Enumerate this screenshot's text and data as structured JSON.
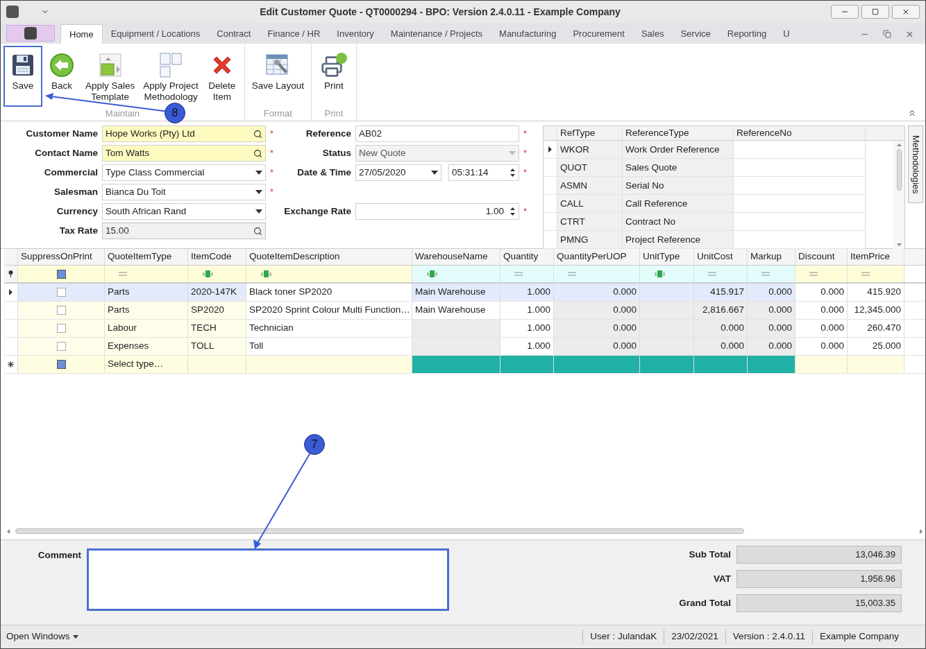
{
  "window": {
    "title": "Edit Customer Quote - QT0000294 - BPO: Version 2.4.0.11 - Example Company"
  },
  "ribbon_tabs": [
    {
      "label": "Home",
      "selected": true
    },
    {
      "label": "Equipment / Locations",
      "selected": false
    },
    {
      "label": "Contract",
      "selected": false
    },
    {
      "label": "Finance / HR",
      "selected": false
    },
    {
      "label": "Inventory",
      "selected": false
    },
    {
      "label": "Maintenance / Projects",
      "selected": false
    },
    {
      "label": "Manufacturing",
      "selected": false
    },
    {
      "label": "Procurement",
      "selected": false
    },
    {
      "label": "Sales",
      "selected": false
    },
    {
      "label": "Service",
      "selected": false
    },
    {
      "label": "Reporting",
      "selected": false
    },
    {
      "label": "U",
      "selected": false
    }
  ],
  "ribbon_groups": [
    {
      "label": "Maintain",
      "buttons": [
        {
          "kind": "save",
          "lines": [
            "Save"
          ],
          "highlighted": true
        },
        {
          "kind": "back",
          "lines": [
            "Back"
          ],
          "highlighted": false
        },
        {
          "kind": "template",
          "lines": [
            "Apply Sales",
            "Template"
          ],
          "highlighted": false
        },
        {
          "kind": "methodology",
          "lines": [
            "Apply Project",
            "Methodology"
          ],
          "highlighted": false
        },
        {
          "kind": "delete",
          "lines": [
            "Delete",
            "Item"
          ],
          "highlighted": false
        }
      ]
    },
    {
      "label": "Format",
      "buttons": [
        {
          "kind": "layout",
          "lines": [
            "Save Layout"
          ],
          "highlighted": false
        }
      ]
    },
    {
      "label": "Print",
      "buttons": [
        {
          "kind": "print",
          "lines": [
            "Print"
          ],
          "highlighted": false
        }
      ]
    }
  ],
  "form_left": [
    {
      "label": "Customer Name",
      "value": "Hope Works (Pty) Ltd",
      "kind": "lookup",
      "marker": "*",
      "accent": true,
      "readonly": false
    },
    {
      "label": "Contact Name",
      "value": "Tom Watts",
      "kind": "lookup",
      "marker": "*",
      "accent": true,
      "readonly": false
    },
    {
      "label": "Commercial",
      "value": "Type Class Commercial",
      "kind": "dropdown",
      "marker": "*",
      "accent": false,
      "readonly": false
    },
    {
      "label": "Salesman",
      "value": "Bianca Du Toit",
      "kind": "dropdown",
      "marker": "*",
      "accent": false,
      "readonly": false
    },
    {
      "label": "Currency",
      "value": "South African Rand",
      "kind": "dropdown",
      "accent": false,
      "readonly": false
    },
    {
      "label": "Tax Rate",
      "value": "15.00",
      "kind": "lookup",
      "accent": false,
      "readonly": true
    }
  ],
  "form_right": [
    {
      "label": "Reference",
      "kind": "text",
      "value": "AB02",
      "marker": "*",
      "disabled": false
    },
    {
      "label": "Status",
      "kind": "dropdown",
      "value": "New Quote",
      "marker": "*",
      "disabled": true
    },
    {
      "label": "Date & Time",
      "kind": "datetime",
      "value": "27/05/2020",
      "time": "05:31:14",
      "marker": "*",
      "disabled": false
    },
    {
      "kind": "blank"
    },
    {
      "label": "Exchange Rate",
      "kind": "spin",
      "value": "1.00",
      "marker": "*",
      "disabled": false
    }
  ],
  "references": {
    "columns": [
      "RefType",
      "ReferenceType",
      "ReferenceNo"
    ],
    "rows": [
      {
        "ref_type": "WKOR",
        "reference_type": "Work Order Reference",
        "selected": true
      },
      {
        "ref_type": "QUOT",
        "reference_type": "Sales Quote",
        "selected": false
      },
      {
        "ref_type": "ASMN",
        "reference_type": "Serial No",
        "selected": false
      },
      {
        "ref_type": "CALL",
        "reference_type": "Call Reference",
        "selected": false
      },
      {
        "ref_type": "CTRT",
        "reference_type": "Contract No",
        "selected": false
      },
      {
        "ref_type": "PMNG",
        "reference_type": "Project Reference",
        "selected": false
      }
    ]
  },
  "side_tab": {
    "label": "Methodologies"
  },
  "items": {
    "check_column": {
      "label": "SuppressOnPrint"
    },
    "columns": [
      {
        "label": "QuoteItemType",
        "calculated": false,
        "readonly": false
      },
      {
        "label": "ItemCode",
        "calculated": false,
        "readonly": false
      },
      {
        "label": "QuoteItemDescription",
        "calculated": false,
        "readonly": false
      },
      {
        "label": "WarehouseName",
        "calculated": true,
        "readonly": false
      },
      {
        "label": "Quantity",
        "calculated": true,
        "readonly": false
      },
      {
        "label": "QuantityPerUOP",
        "calculated": true,
        "readonly": true
      },
      {
        "label": "UnitType",
        "calculated": true,
        "readonly": true
      },
      {
        "label": "UnitCost",
        "calculated": true,
        "readonly": true
      },
      {
        "label": "Markup",
        "calculated": true,
        "readonly": true
      },
      {
        "label": "Discount",
        "calculated": false,
        "readonly": false
      },
      {
        "label": "ItemPrice",
        "calculated": false,
        "readonly": false
      }
    ],
    "filters": [
      {
        "kind": "check"
      },
      {
        "kind": "equals"
      },
      {
        "kind": "abc"
      },
      {
        "kind": "abc"
      },
      {
        "kind": "abc"
      },
      {
        "kind": "equals"
      },
      {
        "kind": "equals"
      },
      {
        "kind": "abc"
      },
      {
        "kind": "equals"
      },
      {
        "kind": "equals"
      },
      {
        "kind": "equals"
      },
      {
        "kind": "equals"
      }
    ],
    "rows": [
      {
        "selected": true,
        "new": false,
        "suppress": false,
        "cells": [
          "Parts",
          "2020-147K",
          "Black toner SP2020",
          "Main Warehouse",
          "1.000",
          "0.000",
          "",
          "415.917",
          "0.000",
          "0.000",
          "415.920"
        ]
      },
      {
        "selected": false,
        "new": false,
        "suppress": false,
        "cells": [
          "Parts",
          "SP2020",
          "SP2020 Sprint Colour Multi Function…",
          "Main Warehouse",
          "1.000",
          "0.000",
          "",
          "2,816.667",
          "0.000",
          "0.000",
          "12,345.000"
        ]
      },
      {
        "selected": false,
        "new": false,
        "suppress": false,
        "cells": [
          "Labour",
          "TECH",
          "Technician",
          "",
          "1.000",
          "0.000",
          "",
          "0.000",
          "0.000",
          "0.000",
          "260.470"
        ]
      },
      {
        "selected": false,
        "new": false,
        "suppress": false,
        "cells": [
          "Expenses",
          "TOLL",
          "Toll",
          "",
          "1.000",
          "0.000",
          "",
          "0.000",
          "0.000",
          "0.000",
          "25.000"
        ]
      },
      {
        "selected": false,
        "new": true,
        "suppress": true,
        "cells": [
          "Select type…",
          "",
          "",
          "",
          "",
          "",
          "",
          "",
          "",
          "",
          ""
        ]
      }
    ]
  },
  "comment": {
    "label": "Comment",
    "highlighted": true
  },
  "totals": [
    {
      "label": "Sub Total",
      "value": "13,046.39"
    },
    {
      "label": "VAT",
      "value": "1,956.96"
    },
    {
      "label": "Grand Total",
      "value": "15,003.35"
    }
  ],
  "callouts": [
    {
      "label": "8"
    },
    {
      "label": "7"
    }
  ],
  "status_bar": {
    "menu": "Open Windows",
    "items": [
      "User : JulandaK",
      "23/02/2021",
      "Version : 2.4.0.11",
      "Example Company"
    ]
  }
}
